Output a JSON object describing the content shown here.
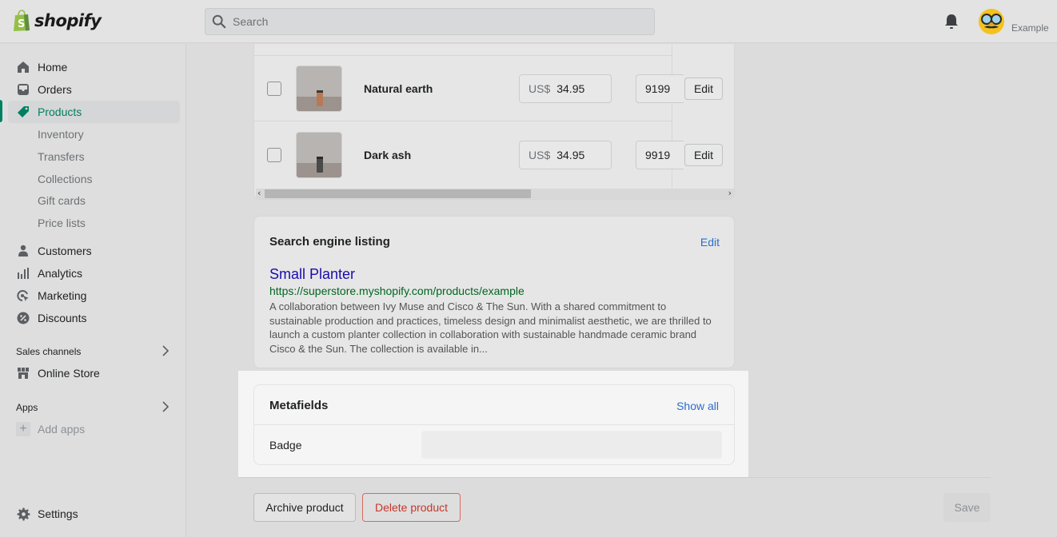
{
  "topbar": {
    "brand": "shopify",
    "search_placeholder": "Search",
    "store_name": "Example"
  },
  "sidebar": {
    "items": [
      {
        "label": "Home",
        "icon": "home-icon"
      },
      {
        "label": "Orders",
        "icon": "inbox-icon"
      },
      {
        "label": "Products",
        "icon": "tag-icon",
        "active": true
      },
      {
        "label": "Customers",
        "icon": "person-icon"
      },
      {
        "label": "Analytics",
        "icon": "bar-chart-icon"
      },
      {
        "label": "Marketing",
        "icon": "target-icon"
      },
      {
        "label": "Discounts",
        "icon": "discount-icon"
      }
    ],
    "product_subitems": [
      "Inventory",
      "Transfers",
      "Collections",
      "Gift cards",
      "Price lists"
    ],
    "sales_channels": {
      "label": "Sales channels",
      "items": [
        {
          "label": "Online Store",
          "icon": "store-icon"
        }
      ]
    },
    "apps": {
      "label": "Apps",
      "add_label": "Add apps"
    },
    "settings_label": "Settings",
    "active_color": "#008060"
  },
  "variants": {
    "rows": [
      {
        "name": "Natural earth",
        "currency": "US$",
        "price": "34.95",
        "quantity": "9199",
        "edit_label": "Edit"
      },
      {
        "name": "Dark ash",
        "currency": "US$",
        "price": "34.95",
        "quantity": "9919",
        "edit_label": "Edit"
      }
    ]
  },
  "seo": {
    "title": "Search engine listing",
    "edit_label": "Edit",
    "page_title": "Small Planter",
    "url": "https://superstore.myshopify.com/products/example",
    "description": "A collaboration between Ivy Muse and Cisco & The Sun. With a shared commitment to sustainable production and practices, timeless design and minimalist aesthetic, we are thrilled to launch a custom planter collection in collaboration with sustainable handmade ceramic brand Cisco & the Sun. The collection is available in..."
  },
  "metafields": {
    "title": "Metafields",
    "show_all_label": "Show all",
    "fields": [
      {
        "label": "Badge",
        "value": ""
      }
    ]
  },
  "footer": {
    "archive_label": "Archive product",
    "delete_label": "Delete product",
    "save_label": "Save"
  }
}
